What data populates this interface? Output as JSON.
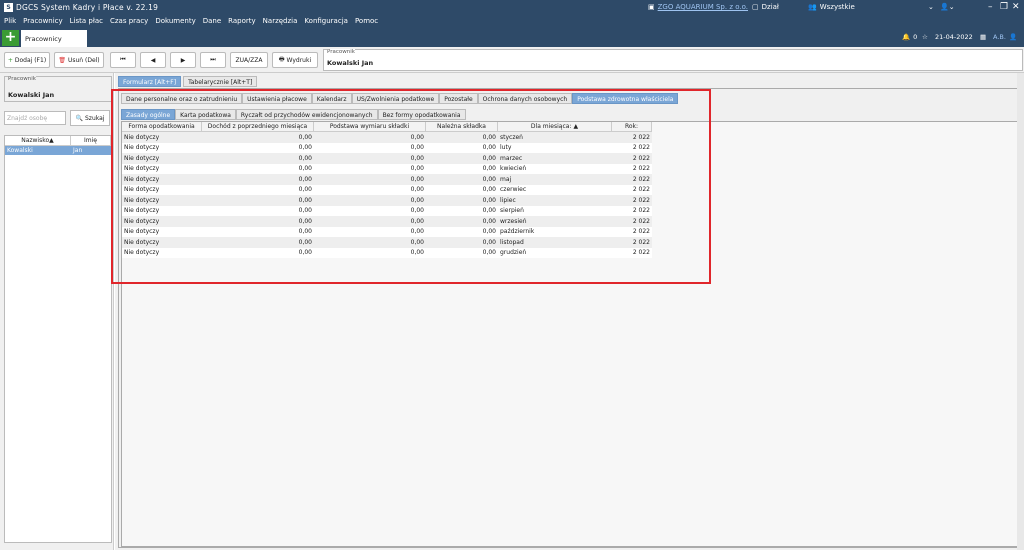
{
  "app": {
    "logo": "S",
    "title": "DGCS System Kadry i Płace v. 22.19"
  },
  "menu": [
    "Plik",
    "Pracownicy",
    "Lista płac",
    "Czas pracy",
    "Dokumenty",
    "Dane",
    "Raporty",
    "Narzędzia",
    "Konfiguracja",
    "Pomoc"
  ],
  "top": {
    "company": "ZGO AQUARIUM Sp. z o.o.",
    "dept": "Dział",
    "all": "Wszystkie",
    "user_initials": "A.B."
  },
  "subbar": {
    "tab": "Pracownicy",
    "notif": "0",
    "date": "21-04-2022"
  },
  "toolbar": {
    "add": "Dodaj (F1)",
    "delete": "Usuń (Del)",
    "first": "⏮",
    "prev": "◀",
    "next": "▶",
    "last": "⏭",
    "zua": "ZUA/ZZA",
    "print": "Wydruki",
    "field_label": "Pracownik",
    "field_value": "Kowalski Jan"
  },
  "left": {
    "label": "Pracownik",
    "value": "Kowalski Jan",
    "search_placeholder": "Znajdź osobę",
    "search_btn": "Szukaj",
    "col1": "Nazwisko",
    "col2": "Imię",
    "row_last": "Kowalski",
    "row_first": "Jan"
  },
  "tabs_main": [
    "Formularz [Alt+F]",
    "Tabelarycznie [Alt+T]"
  ],
  "tabs_section": [
    "Dane personalne oraz o zatrudnieniu",
    "Ustawienia płacowe",
    "Kalendarz",
    "US/Zwolnienia podatkowe",
    "Pozostałe",
    "Ochrona danych osobowych",
    "Podstawa zdrowotna właściciela"
  ],
  "tabs_sub": [
    "Zasady ogólne",
    "Karta podatkowa",
    "Ryczałt od przychodów ewidencjonowanych",
    "Bez formy opodatkowania"
  ],
  "grid": {
    "headers": [
      "Forma opodatkowania",
      "Dochód z poprzedniego miesiąca",
      "Podstawa wymiaru składki",
      "Należna składka",
      "Dla miesiąca:",
      "Rok:"
    ],
    "rows": [
      [
        "Nie dotyczy",
        "0,00",
        "0,00",
        "0,00",
        "styczeń",
        "2 022"
      ],
      [
        "Nie dotyczy",
        "0,00",
        "0,00",
        "0,00",
        "luty",
        "2 022"
      ],
      [
        "Nie dotyczy",
        "0,00",
        "0,00",
        "0,00",
        "marzec",
        "2 022"
      ],
      [
        "Nie dotyczy",
        "0,00",
        "0,00",
        "0,00",
        "kwiecień",
        "2 022"
      ],
      [
        "Nie dotyczy",
        "0,00",
        "0,00",
        "0,00",
        "maj",
        "2 022"
      ],
      [
        "Nie dotyczy",
        "0,00",
        "0,00",
        "0,00",
        "czerwiec",
        "2 022"
      ],
      [
        "Nie dotyczy",
        "0,00",
        "0,00",
        "0,00",
        "lipiec",
        "2 022"
      ],
      [
        "Nie dotyczy",
        "0,00",
        "0,00",
        "0,00",
        "sierpień",
        "2 022"
      ],
      [
        "Nie dotyczy",
        "0,00",
        "0,00",
        "0,00",
        "wrzesień",
        "2 022"
      ],
      [
        "Nie dotyczy",
        "0,00",
        "0,00",
        "0,00",
        "październik",
        "2 022"
      ],
      [
        "Nie dotyczy",
        "0,00",
        "0,00",
        "0,00",
        "listopad",
        "2 022"
      ],
      [
        "Nie dotyczy",
        "0,00",
        "0,00",
        "0,00",
        "grudzień",
        "2 022"
      ]
    ]
  }
}
